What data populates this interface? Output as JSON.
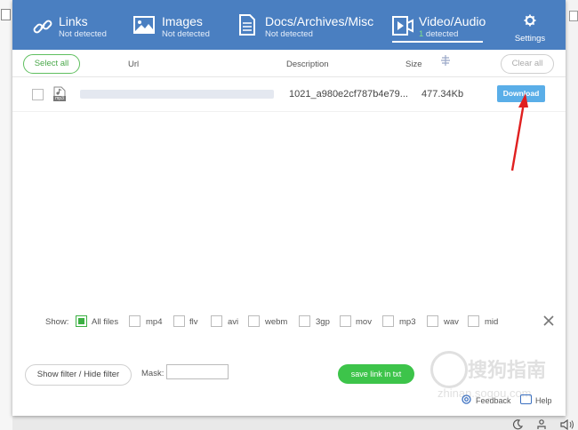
{
  "tabs": [
    {
      "title": "Links",
      "status": "Not detected",
      "icon": "link-icon"
    },
    {
      "title": "Images",
      "status": "Not detected",
      "icon": "image-icon"
    },
    {
      "title": "Docs/Archives/Misc",
      "status": "Not detected",
      "icon": "document-icon"
    },
    {
      "title": "Video/Audio",
      "status_count": "1",
      "status_text": " detected",
      "icon": "video-audio-icon",
      "active": true
    }
  ],
  "settings_label": "Settings",
  "toolbar": {
    "select_all": "Select all",
    "clear_all": "Clear all"
  },
  "columns": {
    "url": "Url",
    "description": "Description",
    "size": "Size"
  },
  "rows": [
    {
      "file_type_label": "mp3",
      "description": "1021_a980e2cf787b4e79...",
      "size": "477.34Kb",
      "download_label": "Download"
    }
  ],
  "filters": {
    "show_label": "Show:",
    "options": [
      {
        "label": "All files",
        "checked": true
      },
      {
        "label": "mp4",
        "checked": false
      },
      {
        "label": "flv",
        "checked": false
      },
      {
        "label": "avi",
        "checked": false
      },
      {
        "label": "webm",
        "checked": false
      },
      {
        "label": "3gp",
        "checked": false
      },
      {
        "label": "mov",
        "checked": false
      },
      {
        "label": "mp3",
        "checked": false
      },
      {
        "label": "wav",
        "checked": false
      },
      {
        "label": "mid",
        "checked": false
      }
    ]
  },
  "bottom": {
    "filter_toggle": "Show filter / Hide filter",
    "mask_label": "Mask:",
    "mask_value": "",
    "save_label": "save link in txt",
    "feedback": "Feedback",
    "help": "Help"
  },
  "watermark": {
    "text": "搜狗指南",
    "sub": "zhinan.sogou.com"
  },
  "colors": {
    "header": "#4a7fc1",
    "accent_green": "#3dc44a",
    "download_blue": "#5aaee8",
    "arrow_red": "#e02020"
  }
}
